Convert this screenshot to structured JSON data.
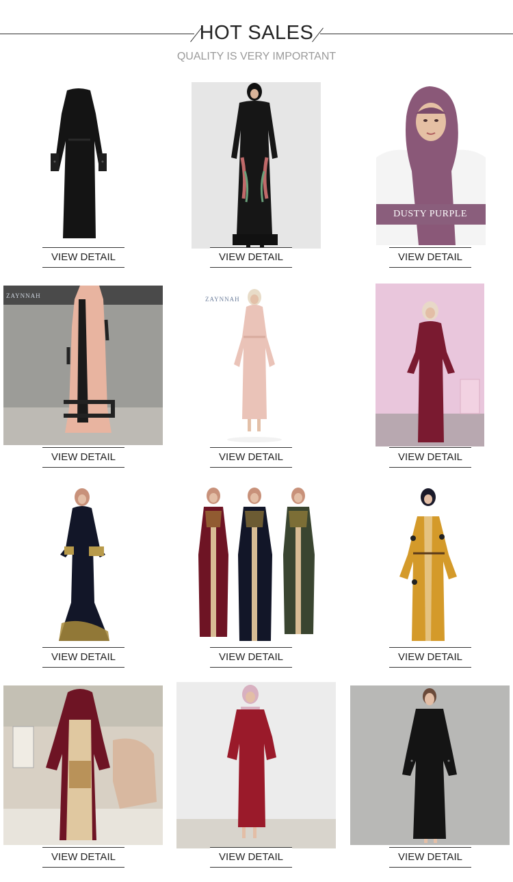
{
  "header": {
    "title": "HOT SALES",
    "subtitle": "QUALITY IS VERY IMPORTANT"
  },
  "products": [
    {
      "button": "VIEW DETAIL",
      "image": "black-abaya-tiered-sleeves"
    },
    {
      "button": "VIEW DETAIL",
      "image": "black-embroidered-kimono-abaya"
    },
    {
      "button": "VIEW DETAIL",
      "image": "dusty-purple-hijab",
      "tag": "DUSTY PURPLE"
    },
    {
      "button": "VIEW DETAIL",
      "image": "peach-lace-open-abaya",
      "logo": "ZAYNNAH"
    },
    {
      "button": "VIEW DETAIL",
      "image": "blush-pink-belted-dress",
      "logo": "ZAYNNAH"
    },
    {
      "button": "VIEW DETAIL",
      "image": "burgundy-bell-sleeve-dress"
    },
    {
      "button": "VIEW DETAIL",
      "image": "navy-gold-embroidered-mermaid-dress"
    },
    {
      "button": "VIEW DETAIL",
      "image": "three-embroidered-abayas"
    },
    {
      "button": "VIEW DETAIL",
      "image": "mustard-belted-abaya"
    },
    {
      "button": "VIEW DETAIL",
      "image": "burgundy-velvet-embroidered-abaya"
    },
    {
      "button": "VIEW DETAIL",
      "image": "red-pleated-bell-sleeve-dress"
    },
    {
      "button": "VIEW DETAIL",
      "image": "black-pleated-embellished-dress"
    }
  ],
  "colors": {
    "text": "#222222",
    "subtitle": "#9a9a9a",
    "tag": "#8a5e7c"
  }
}
